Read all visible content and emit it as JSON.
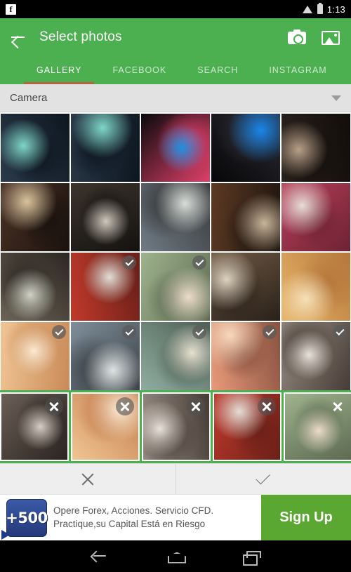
{
  "status_bar": {
    "notification_icon": "facebook-icon",
    "wifi_icon": "wifi-icon",
    "battery_icon": "battery-icon",
    "time": "1:13"
  },
  "app_bar": {
    "back_icon": "back-arrow-icon",
    "title": "Select photos",
    "camera_icon": "camera-icon",
    "gallery_icon": "image-icon"
  },
  "tabs": [
    {
      "label": "GALLERY",
      "active": true
    },
    {
      "label": "FACEBOOK",
      "active": false
    },
    {
      "label": "SEARCH",
      "active": false
    },
    {
      "label": "INSTAGRAM",
      "active": false
    }
  ],
  "album_selector": {
    "value": "Camera",
    "caret_icon": "chevron-down-icon"
  },
  "grid": {
    "columns": 5,
    "photos": [
      {
        "id": "p1",
        "desc": "phone-home-screen-apps",
        "selected": false,
        "c1": "#2b3a4a",
        "c2": "#7fd6c8",
        "c3": "#0d1620"
      },
      {
        "id": "p2",
        "desc": "phone-home-screen-apps-2",
        "selected": false,
        "c1": "#2b3a4a",
        "c2": "#7fd6c8",
        "c3": "#0d1620"
      },
      {
        "id": "p3",
        "desc": "phone-blue-screen-quiz",
        "selected": false,
        "c1": "#0a0a0c",
        "c2": "#1f8fe0",
        "c3": "#e0406a"
      },
      {
        "id": "p4",
        "desc": "phone-question-1-screen",
        "selected": false,
        "c1": "#070708",
        "c2": "#1b86e8",
        "c3": "#2a2a33"
      },
      {
        "id": "p5",
        "desc": "people-at-table-dark",
        "selected": false,
        "c1": "#2a221d",
        "c2": "#b9a089",
        "c3": "#120d0a"
      },
      {
        "id": "p6",
        "desc": "person-at-desk-lamp",
        "selected": false,
        "c1": "#4a3226",
        "c2": "#d9c39d",
        "c3": "#1b120d"
      },
      {
        "id": "p7",
        "desc": "black-cat-on-table",
        "selected": false,
        "c1": "#3c342c",
        "c2": "#cfc8bd",
        "c3": "#141210"
      },
      {
        "id": "p8",
        "desc": "man-on-bed-selfie",
        "selected": false,
        "c1": "#6f7b85",
        "c2": "#d8ddd8",
        "c3": "#3a3c3d"
      },
      {
        "id": "p9",
        "desc": "bedroom-wooden-wardrobe",
        "selected": false,
        "c1": "#5d3a24",
        "c2": "#c9b49a",
        "c3": "#1d140e"
      },
      {
        "id": "p10",
        "desc": "woman-in-red-dress",
        "selected": false,
        "c1": "#b8405a",
        "c2": "#e8dcd6",
        "c3": "#6e2233"
      },
      {
        "id": "p11",
        "desc": "grey-cat-checkered-cloth",
        "selected": false,
        "c1": "#6b6356",
        "c2": "#cfd2c4",
        "c3": "#2c2722"
      },
      {
        "id": "p12",
        "desc": "man-red-hoodie-smiling",
        "selected": true,
        "c1": "#c0392b",
        "c2": "#e3ded6",
        "c3": "#6b2018"
      },
      {
        "id": "p13",
        "desc": "person-holding-cat-vintage",
        "selected": true,
        "c1": "#9fb38d",
        "c2": "#ecdcc8",
        "c3": "#5d6b52"
      },
      {
        "id": "p14",
        "desc": "dining-room-table",
        "selected": false,
        "c1": "#6d5742",
        "c2": "#ded2bf",
        "c3": "#2a211a"
      },
      {
        "id": "p15",
        "desc": "desert-sand-dunes",
        "selected": false,
        "c1": "#e8b56a",
        "c2": "#f6e0b8",
        "c3": "#b5773a"
      },
      {
        "id": "p16",
        "desc": "mountain-sunrise-pixel",
        "selected": true,
        "c1": "#f0c693",
        "c2": "#fbe9d2",
        "c3": "#c98a58"
      },
      {
        "id": "p17",
        "desc": "man-on-boat-sea",
        "selected": true,
        "c1": "#7f8f9b",
        "c2": "#dfe4e2",
        "c3": "#3d4348"
      },
      {
        "id": "p18",
        "desc": "couple-portrait-outdoors",
        "selected": true,
        "c1": "#8fae9f",
        "c2": "#e6e0cf",
        "c3": "#4e5f55"
      },
      {
        "id": "p19",
        "desc": "man-at-sunset-sky",
        "selected": true,
        "c1": "#e89a7a",
        "c2": "#f7d7bc",
        "c3": "#8a5340"
      },
      {
        "id": "p20",
        "desc": "man-close-up-selfie",
        "selected": true,
        "c1": "#9a8f86",
        "c2": "#e9e2da",
        "c3": "#463c35"
      }
    ]
  },
  "selected_strip": {
    "remove_icon": "close-icon",
    "items": [
      {
        "id": "s1",
        "desc": "man-close-up-portrait",
        "c1": "#6b5f57",
        "c2": "#d6cdc4",
        "c3": "#2b241f"
      },
      {
        "id": "s2",
        "desc": "mountain-sunrise-pixel",
        "c1": "#f0c693",
        "c2": "#fbe9d2",
        "c3": "#c27a4a"
      },
      {
        "id": "s3",
        "desc": "man-close-up-selfie",
        "c1": "#9a8f86",
        "c2": "#e9e2da",
        "c3": "#463c35"
      },
      {
        "id": "s4",
        "desc": "man-red-hoodie-smiling",
        "c1": "#c0392b",
        "c2": "#e3ded6",
        "c3": "#6b2018"
      },
      {
        "id": "s5",
        "desc": "person-holding-cat-vintage",
        "c1": "#9fb38d",
        "c2": "#ecdcc8",
        "c3": "#5d6b52"
      }
    ]
  },
  "action_bar": {
    "cancel_icon": "close-icon",
    "confirm_icon": "check-icon"
  },
  "ad": {
    "logo_text": "+500",
    "ad_choices_icon": "ad-choices-icon",
    "line1": "Opere Forex, Acciones. Servicio CFD.",
    "line2": "Practique,su Capital Está en Riesgo",
    "cta_label": "Sign Up"
  },
  "nav_bar": {
    "back_icon": "nav-back-icon",
    "home_icon": "nav-home-icon",
    "recents_icon": "nav-recents-icon"
  },
  "colors": {
    "primary_green": "#4CAF50",
    "tab_indicator": "#b5643c",
    "album_bar": "#e2e2e2",
    "action_bar": "#eeeeee",
    "ad_cta_green": "#5aa832",
    "ad_logo_blue": "#3b5aa8"
  }
}
